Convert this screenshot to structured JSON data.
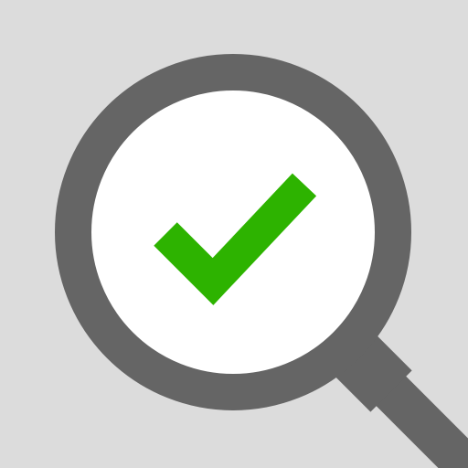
{
  "icon": {
    "name": "search-verified-icon",
    "symbol": "magnifying-glass-with-checkmark",
    "colors": {
      "background": "#DCDCDC",
      "lens_fill": "#FFFFFF",
      "frame": "#656565",
      "checkmark": "#2DB300"
    }
  }
}
